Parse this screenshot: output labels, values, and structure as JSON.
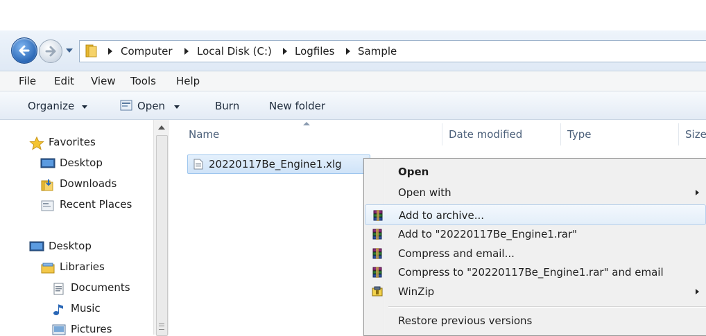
{
  "breadcrumb": [
    "Computer",
    "Local Disk (C:)",
    "Logfiles",
    "Sample"
  ],
  "menu": [
    "File",
    "Edit",
    "View",
    "Tools",
    "Help"
  ],
  "toolbar": {
    "organize": "Organize",
    "open": "Open",
    "burn": "Burn",
    "new_folder": "New folder"
  },
  "nav": {
    "favorites": "Favorites",
    "fav_items": [
      "Desktop",
      "Downloads",
      "Recent Places"
    ],
    "desktop": "Desktop",
    "libraries": "Libraries",
    "lib_items": [
      "Documents",
      "Music",
      "Pictures"
    ]
  },
  "columns": {
    "name": "Name",
    "date": "Date modified",
    "type": "Type",
    "size": "Size"
  },
  "file": {
    "name": "20220117Be_Engine1.xlg"
  },
  "context_menu": [
    {
      "label": "Open",
      "bold": true,
      "icon": "",
      "submenu": false
    },
    {
      "label": "Open with",
      "bold": false,
      "icon": "",
      "submenu": true
    },
    {
      "label": "Add to archive...",
      "bold": false,
      "icon": "winrar-icon",
      "submenu": false,
      "hover": true
    },
    {
      "label": "Add to \"20220117Be_Engine1.rar\"",
      "bold": false,
      "icon": "winrar-icon",
      "submenu": false
    },
    {
      "label": "Compress and email...",
      "bold": false,
      "icon": "winrar-icon",
      "submenu": false
    },
    {
      "label": "Compress to \"20220117Be_Engine1.rar\" and email",
      "bold": false,
      "icon": "winrar-icon",
      "submenu": false
    },
    {
      "label": "WinZip",
      "bold": false,
      "icon": "winzip-icon",
      "submenu": true
    },
    {
      "label": "Restore previous versions",
      "bold": false,
      "icon": "",
      "submenu": false
    }
  ]
}
